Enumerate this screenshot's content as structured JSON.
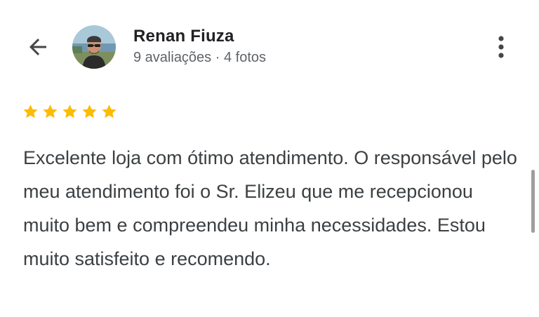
{
  "header": {
    "back_icon": "arrow-back-icon",
    "reviewer_name": "Renan Fiuza",
    "reviewer_meta": "9 avaliações · 4 fotos",
    "more_icon": "more-vert-icon"
  },
  "review": {
    "rating": 5,
    "max_rating": 5,
    "star_color": "#fbbc04",
    "text": "Excelente loja com ótimo atendimento. O responsável pelo meu atendimento foi o Sr. Elizeu que me recepcionou muito bem e compreendeu minha necessidades. Estou muito satisfeito e recomendo."
  }
}
